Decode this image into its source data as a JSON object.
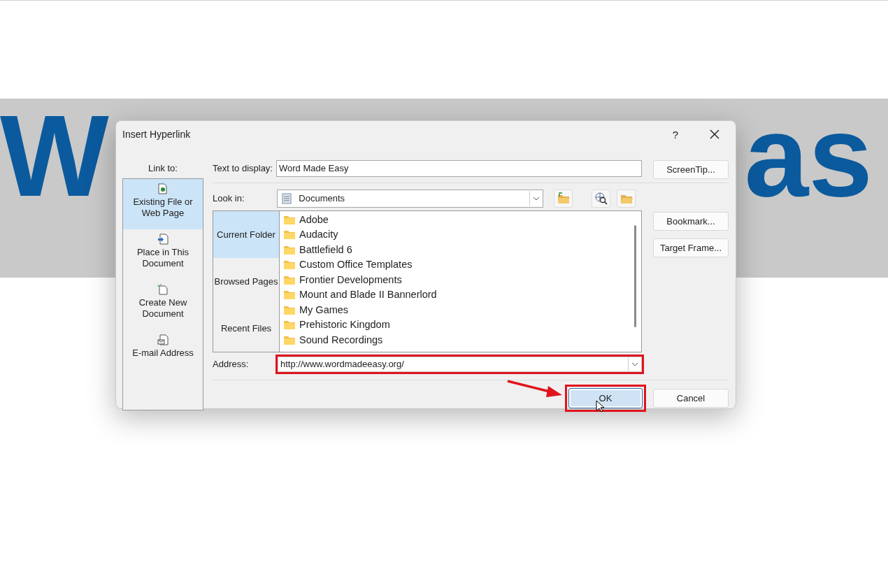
{
  "banner": {
    "fragments": [
      "W",
      "as"
    ]
  },
  "dialog": {
    "title": "Insert Hyperlink",
    "help": "?",
    "link_to": {
      "label": "Link to:",
      "items": [
        {
          "kind": "file",
          "label": "Existing File or Web Page",
          "selected": true
        },
        {
          "kind": "place",
          "label": "Place in This Document",
          "selected": false
        },
        {
          "kind": "new",
          "label": "Create New Document",
          "selected": false
        },
        {
          "kind": "email",
          "label": "E-mail Address",
          "selected": false
        }
      ]
    },
    "text_to_display": {
      "label": "Text to display:",
      "value": "Word Made Easy"
    },
    "look_in": {
      "label": "Look in:",
      "value": "Documents"
    },
    "views": [
      {
        "label": "Current Folder",
        "selected": true
      },
      {
        "label": "Browsed Pages",
        "selected": false
      },
      {
        "label": "Recent Files",
        "selected": false
      }
    ],
    "files": [
      "Adobe",
      "Audacity",
      "Battlefield 6",
      "Custom Office Templates",
      "Frontier Developments",
      "Mount and Blade II Bannerlord",
      "My Games",
      "Prehistoric Kingdom",
      "Sound Recordings"
    ],
    "address": {
      "label": "Address:",
      "value": "http://www.wordmadeeasy.org/",
      "highlighted": true
    },
    "side_buttons": [
      "ScreenTip...",
      "Bookmark...",
      "Target Frame..."
    ],
    "ok": {
      "label": "OK",
      "highlighted": true,
      "pointer_arrow": true
    },
    "cancel": {
      "label": "Cancel"
    }
  }
}
